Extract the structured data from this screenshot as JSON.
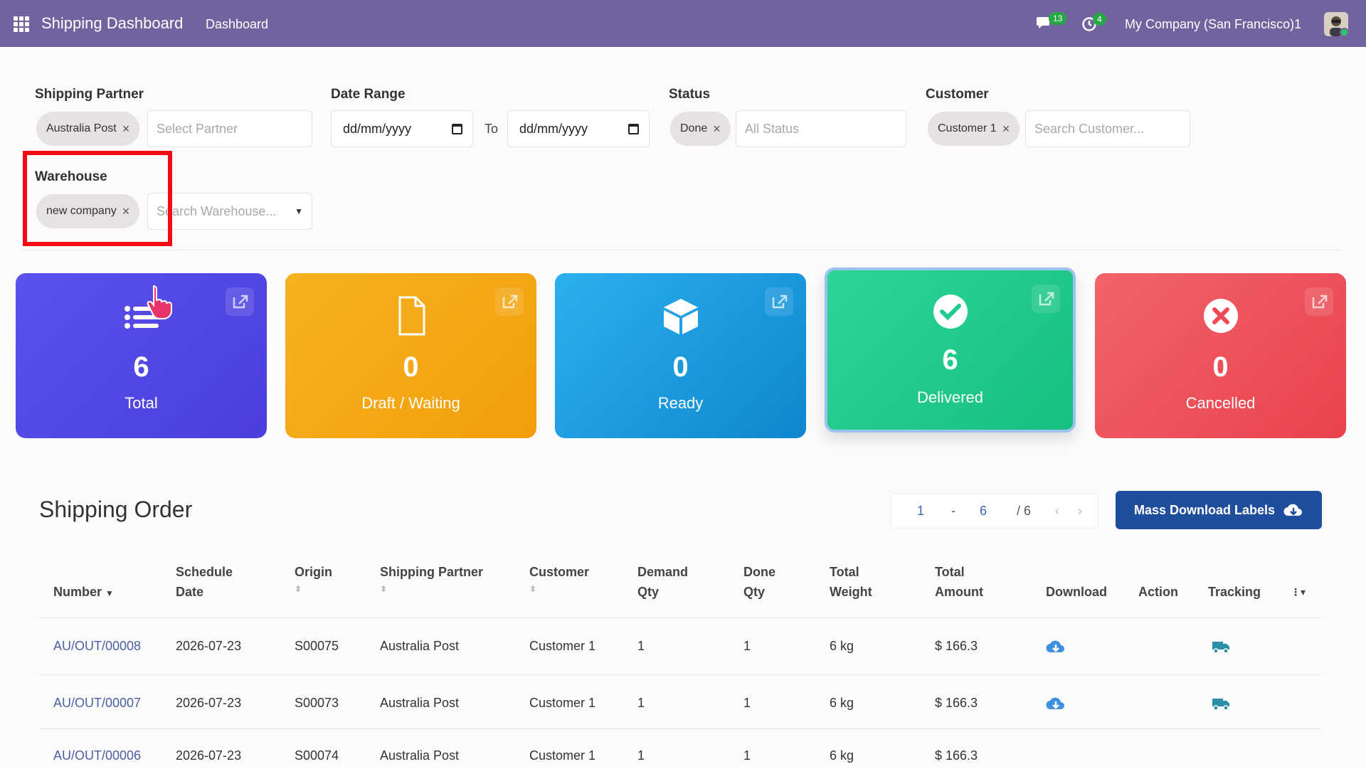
{
  "header": {
    "app_title": "Shipping Dashboard",
    "menu_item": "Dashboard",
    "messages_count": "13",
    "activities_count": "4",
    "company": "My Company (San Francisco)1"
  },
  "filters": {
    "shipping_partner": {
      "label": "Shipping Partner",
      "selected": "Australia Post",
      "placeholder": "Select Partner"
    },
    "date_range": {
      "label": "Date Range",
      "from": "dd/mm/yyyy",
      "to_label": "To",
      "to": "dd/mm/yyyy"
    },
    "status": {
      "label": "Status",
      "selected": "Done",
      "placeholder": "All Status"
    },
    "customer": {
      "label": "Customer",
      "selected": "Customer 1",
      "placeholder": "Search Customer..."
    },
    "warehouse": {
      "label": "Warehouse",
      "selected": "new company",
      "placeholder": "Search Warehouse..."
    }
  },
  "cards": [
    {
      "value": "6",
      "label": "Total",
      "color": "#5046e4",
      "icon": "list-icon"
    },
    {
      "value": "0",
      "label": "Draft / Waiting",
      "color": "#f5a716",
      "icon": "file-icon"
    },
    {
      "value": "0",
      "label": "Ready",
      "color": "#1c9fe0",
      "icon": "box-icon"
    },
    {
      "value": "6",
      "label": "Delivered",
      "color": "#1fcc8b",
      "icon": "check-circle-icon"
    },
    {
      "value": "0",
      "label": "Cancelled",
      "color": "#ee4c55",
      "icon": "x-circle-icon"
    }
  ],
  "orders": {
    "title": "Shipping Order",
    "pager": {
      "start": "1",
      "sep": "-",
      "end": "6",
      "total": "/ 6"
    },
    "mass_download_label": "Mass Download Labels",
    "columns": [
      {
        "line1": "Number",
        "line2": ""
      },
      {
        "line1": "Schedule",
        "line2": "Date"
      },
      {
        "line1": "Origin",
        "line2": ""
      },
      {
        "line1": "Shipping Partner",
        "line2": ""
      },
      {
        "line1": "Customer",
        "line2": ""
      },
      {
        "line1": "Demand",
        "line2": "Qty"
      },
      {
        "line1": "Done",
        "line2": "Qty"
      },
      {
        "line1": "Total",
        "line2": "Weight"
      },
      {
        "line1": "Total",
        "line2": "Amount"
      },
      {
        "line1": "Download",
        "line2": ""
      },
      {
        "line1": "Action",
        "line2": ""
      },
      {
        "line1": "Tracking",
        "line2": ""
      }
    ],
    "rows": [
      {
        "number": "AU/OUT/00008",
        "date": "2026-07-23",
        "origin": "S00075",
        "partner": "Australia Post",
        "customer": "Customer 1",
        "demand": "1",
        "done": "1",
        "weight": "6 kg",
        "amount": "$ 166.3"
      },
      {
        "number": "AU/OUT/00007",
        "date": "2026-07-23",
        "origin": "S00073",
        "partner": "Australia Post",
        "customer": "Customer 1",
        "demand": "1",
        "done": "1",
        "weight": "6 kg",
        "amount": "$ 166.3"
      },
      {
        "number": "AU/OUT/00006",
        "date": "2026-07-23",
        "origin": "S00074",
        "partner": "Australia Post",
        "customer": "Customer 1",
        "demand": "1",
        "done": "1",
        "weight": "6 kg",
        "amount": "$ 166.3"
      }
    ]
  }
}
